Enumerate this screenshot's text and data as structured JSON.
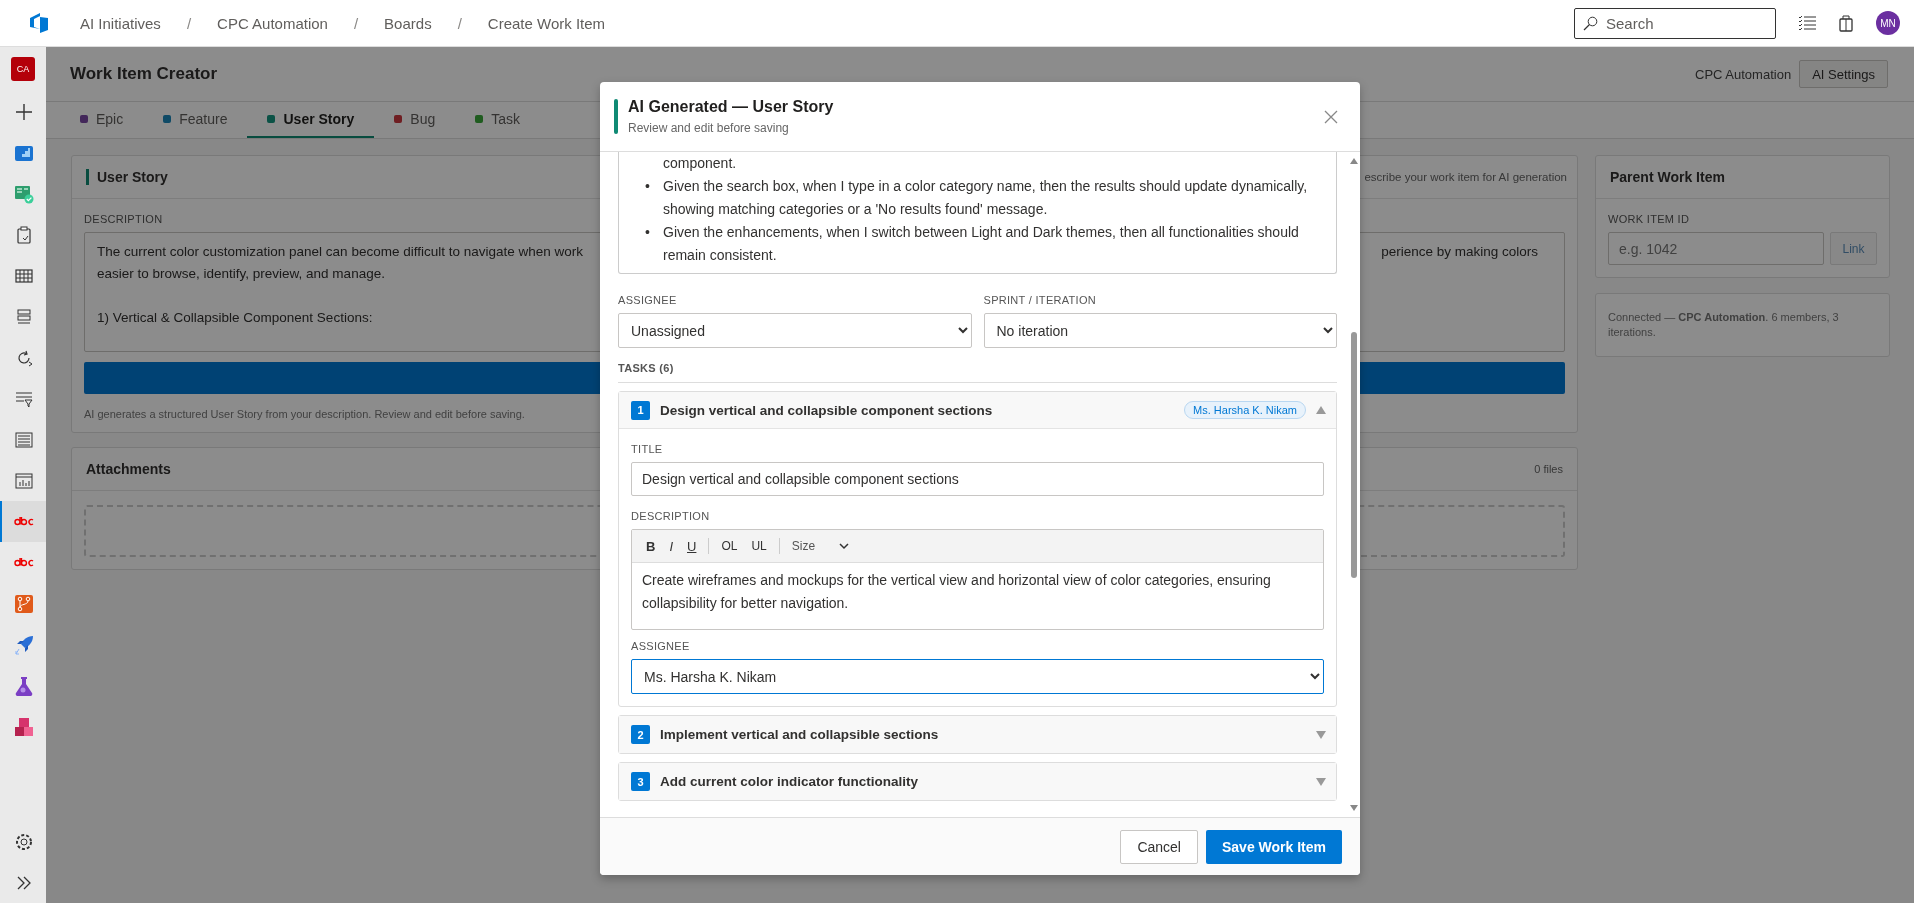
{
  "topbar": {
    "breadcrumbs": [
      "AI Initiatives",
      "CPC Automation",
      "Boards",
      "Create Work Item"
    ],
    "separator": "/",
    "search": {
      "placeholder": "Search"
    },
    "avatar": "MN"
  },
  "sidebar": {
    "badge": "CA",
    "items": [
      {
        "kind": "plus",
        "selected": false
      },
      {
        "kind": "overview",
        "selected": false
      },
      {
        "kind": "boards",
        "selected": false
      },
      {
        "kind": "clipboard",
        "selected": false
      },
      {
        "kind": "grid",
        "selected": false
      },
      {
        "kind": "stack",
        "selected": false
      },
      {
        "kind": "cycle",
        "selected": false
      },
      {
        "kind": "filter",
        "selected": false
      },
      {
        "kind": "lines",
        "selected": false
      },
      {
        "kind": "report",
        "selected": false
      },
      {
        "kind": "logo",
        "selected": true
      },
      {
        "kind": "logo",
        "selected": false
      },
      {
        "kind": "repos",
        "selected": false
      },
      {
        "kind": "rocket",
        "selected": false
      },
      {
        "kind": "flask",
        "selected": false
      },
      {
        "kind": "boxes",
        "selected": false
      }
    ],
    "bottom": [
      {
        "kind": "settings"
      },
      {
        "kind": "expand"
      }
    ]
  },
  "page": {
    "title": "Work Item Creator",
    "project": "CPC Automation",
    "settings_button": "AI Settings",
    "tabs": [
      {
        "label": "Epic",
        "color": "#43275a",
        "selected": false
      },
      {
        "label": "Feature",
        "color": "#0f4a66",
        "selected": false
      },
      {
        "label": "User Story",
        "color": "#0b5246",
        "selected": true
      },
      {
        "label": "Bug",
        "color": "#6f1e22",
        "selected": false
      },
      {
        "label": "Task",
        "color": "#1f5c1f",
        "selected": false
      }
    ]
  },
  "story_panel": {
    "title": "User Story",
    "hint": "escribe your work item for AI generation",
    "description_label": "DESCRIPTION",
    "description_paragraphs": [
      [
        {
          "left": "The current color customization panel can become difficult to navigate when work",
          "right": "perience by making colors"
        },
        {
          "left": "easier to browse, identify, preview, and manage."
        }
      ],
      [
        {
          "left": "1) Vertical & Collapsible Component Sections:"
        }
      ]
    ],
    "note": "AI generates a structured User Story from your description. Review and edit before saving."
  },
  "attachments": {
    "title": "Attachments",
    "count": "0 files"
  },
  "parent": {
    "title": "Parent Work Item",
    "label": "WORK ITEM ID",
    "placeholder": "e.g. 1042",
    "button": "Link",
    "status": "Connected — **CPC Automation**. 6 members, 3 iterations."
  },
  "modal": {
    "title": "AI Generated — User Story",
    "subtitle": "Review and edit before saving",
    "criteria": [
      {
        "kind": "continuation",
        "text": "component."
      },
      {
        "kind": "bullet",
        "marker": "•",
        "text": "Given the search box, when I type in a color category name, then the results should update dynamically, showing matching categories or a 'No results found' message."
      },
      {
        "kind": "bullet",
        "marker": "•",
        "text": "Given the enhancements, when I switch between Light and Dark themes, then all functionalities should remain consistent."
      }
    ],
    "assignee": {
      "label": "ASSIGNEE",
      "value": "Unassigned"
    },
    "sprint": {
      "label": "SPRINT / ITERATION",
      "value": "No iteration"
    },
    "tasks_label": "TASKS (6)",
    "tasks": [
      {
        "number": "1",
        "title": "Design vertical and collapsible component sections",
        "badge": "Ms. Harsha K. Nikam",
        "expanded": true,
        "detail": {
          "title_label": "TITLE",
          "title_value": "Design vertical and collapsible component sections",
          "description_label": "DESCRIPTION",
          "toolbar": [
            {
              "label": "B",
              "kind": "bold"
            },
            {
              "label": "I",
              "kind": "italic"
            },
            {
              "label": "U",
              "kind": "underline"
            },
            {
              "label": "OL",
              "kind": "plain"
            },
            {
              "label": "UL",
              "kind": "plain"
            }
          ],
          "size": "Size",
          "description": "Create wireframes and mockups for the vertical view and horizontal view of color categories, ensuring collapsibility for better navigation.",
          "assignee_label": "ASSIGNEE",
          "assignee": "Ms. Harsha K. Nikam"
        }
      },
      {
        "number": "2",
        "title": "Implement vertical and collapsible sections",
        "expanded": false
      },
      {
        "number": "3",
        "title": "Add current color indicator functionality",
        "expanded": false
      }
    ],
    "cancel": "Cancel",
    "save": "Save Work Item"
  }
}
